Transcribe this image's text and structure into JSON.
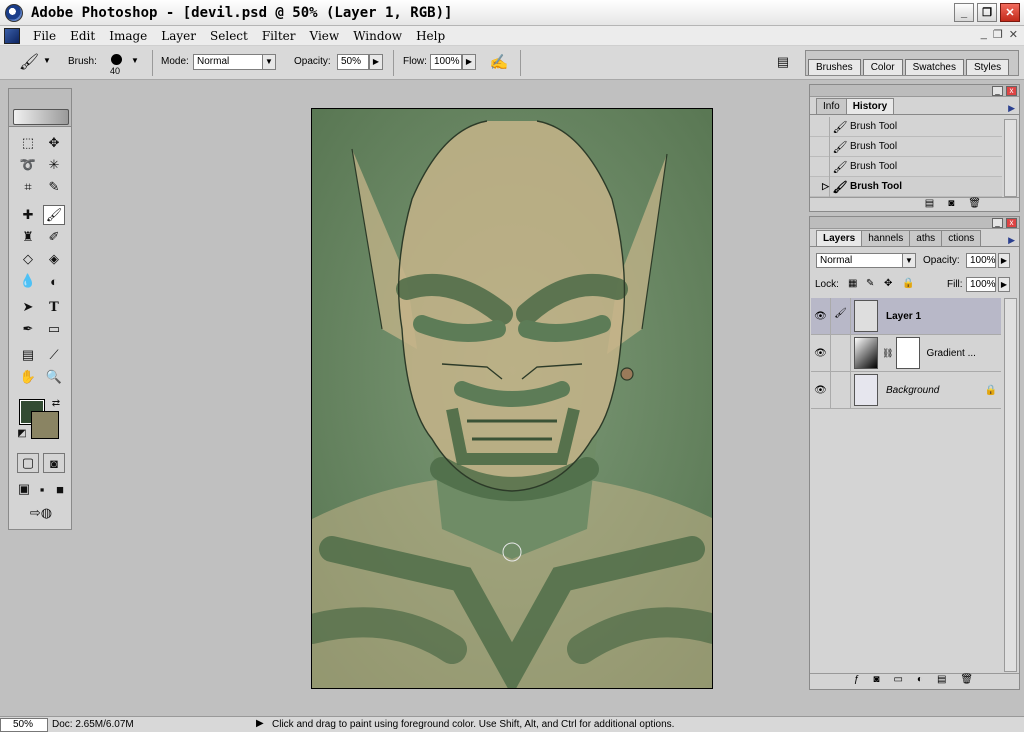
{
  "window": {
    "title": "Adobe Photoshop - [devil.psd @ 50% (Layer 1, RGB)]"
  },
  "menu": {
    "items": [
      "File",
      "Edit",
      "Image",
      "Layer",
      "Select",
      "Filter",
      "View",
      "Window",
      "Help"
    ]
  },
  "options": {
    "brush_label": "Brush:",
    "brush_size": "40",
    "mode_label": "Mode:",
    "mode_value": "Normal",
    "opacity_label": "Opacity:",
    "opacity_value": "50%",
    "flow_label": "Flow:",
    "flow_value": "100%"
  },
  "palette_well": {
    "tabs": [
      "Brushes",
      "Color",
      "Swatches",
      "Styles"
    ]
  },
  "colors": {
    "foreground": "#334c33",
    "background": "#8a8463"
  },
  "history_panel": {
    "tabs": [
      "Info",
      "History"
    ],
    "active_tab": "History",
    "items": [
      "Brush Tool",
      "Brush Tool",
      "Brush Tool",
      "Brush Tool"
    ],
    "current_index": 3
  },
  "layers_panel": {
    "tabs": [
      "Layers",
      "Channels",
      "Paths",
      "Actions"
    ],
    "tab_labels_visible": [
      "Layers",
      "hannels",
      "aths",
      "ctions"
    ],
    "blend_mode": "Normal",
    "opacity_label": "Opacity:",
    "opacity_value": "100%",
    "lock_label": "Lock:",
    "fill_label": "Fill:",
    "fill_value": "100%",
    "layers": [
      {
        "name": "Layer 1",
        "visible": true,
        "selected": true
      },
      {
        "name": "Gradient ...",
        "visible": true,
        "selected": false
      },
      {
        "name": "Background",
        "visible": true,
        "selected": false,
        "locked": true
      }
    ]
  },
  "status": {
    "zoom": "50%",
    "doc": "Doc: 2.65M/6.07M",
    "hint": "Click and drag to paint using foreground color.  Use Shift, Alt, and Ctrl for additional options."
  }
}
